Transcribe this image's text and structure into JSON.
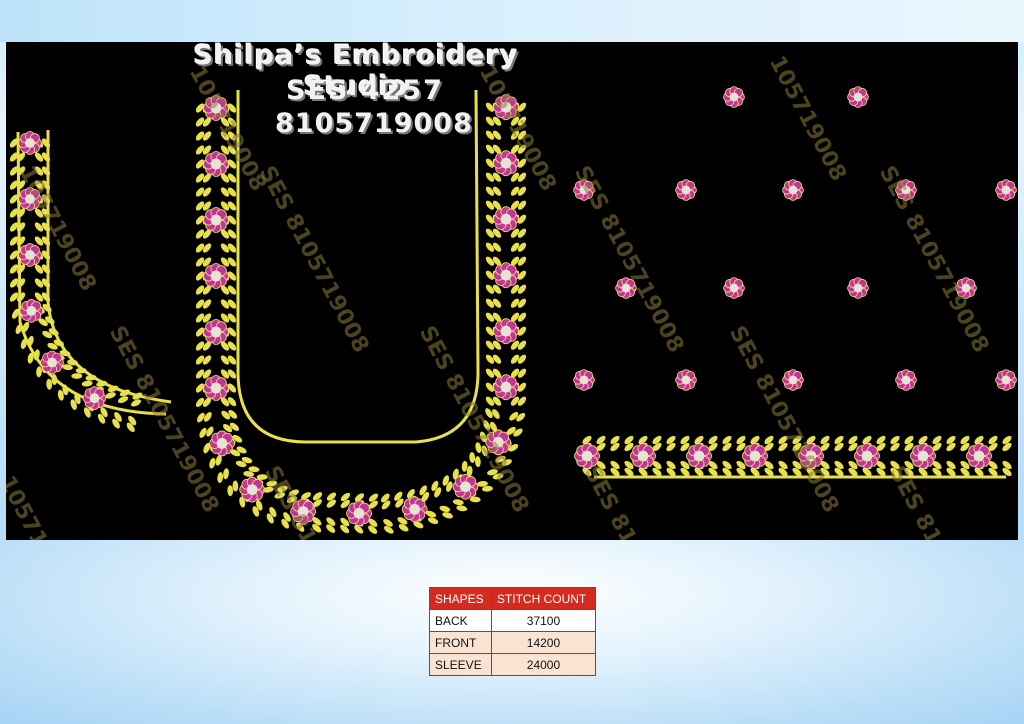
{
  "header": {
    "studio_name": "Shilpa’s Embroidery Studio",
    "design_code": "SES 4257",
    "phone": "8105719008"
  },
  "watermark": {
    "text": "SES 8105719008",
    "short": "105719008"
  },
  "colors": {
    "panel": "#000000",
    "vine": "#e8e04a",
    "flower": "#c2349a",
    "flower_center": "#e6e2d4"
  },
  "stitch_table": {
    "headers": [
      "SHAPES",
      "STITCH COUNT"
    ],
    "rows": [
      {
        "shape": "BACK",
        "count": "37100"
      },
      {
        "shape": "FRONT",
        "count": "14200"
      },
      {
        "shape": "SLEEVE",
        "count": "24000"
      }
    ]
  }
}
